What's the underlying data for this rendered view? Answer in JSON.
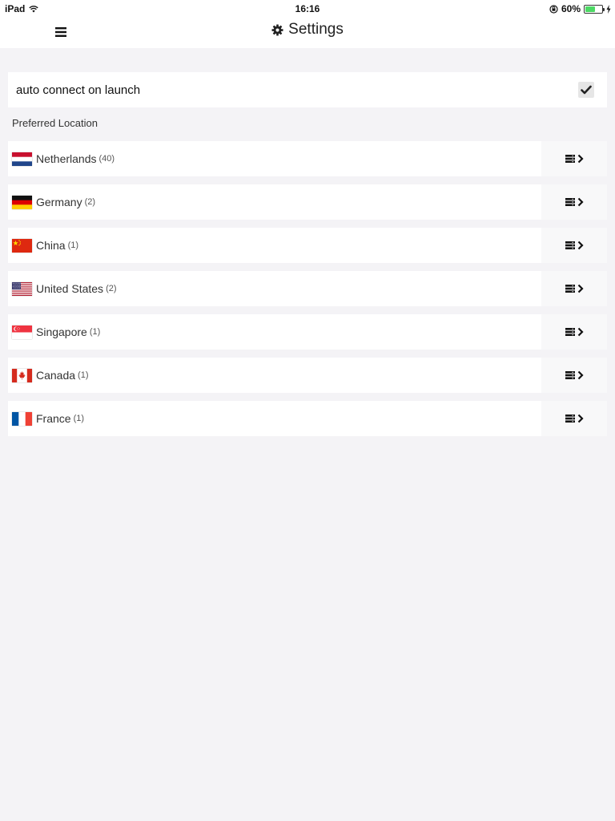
{
  "status_bar": {
    "device": "iPad",
    "time": "16:16",
    "battery": "60%",
    "battery_level": 0.6
  },
  "nav": {
    "title": "Settings"
  },
  "settings": {
    "auto_connect_label": "auto connect on launch",
    "auto_connect_checked": true,
    "preferred_location_label": "Preferred Location"
  },
  "locations": [
    {
      "name": "Netherlands",
      "count": "(40)",
      "flag": "netherlands"
    },
    {
      "name": "Germany",
      "count": "(2)",
      "flag": "germany"
    },
    {
      "name": "China",
      "count": "(1)",
      "flag": "china"
    },
    {
      "name": "United States",
      "count": "(2)",
      "flag": "usa"
    },
    {
      "name": "Singapore",
      "count": "(1)",
      "flag": "singapore"
    },
    {
      "name": "Canada",
      "count": "(1)",
      "flag": "canada"
    },
    {
      "name": "France",
      "count": "(1)",
      "flag": "france"
    }
  ],
  "icons": {
    "menu": "menu-icon",
    "gear": "gear-icon",
    "server_list": "server-list-icon",
    "chevron": "chevron-right-icon",
    "check": "check-icon"
  },
  "colors": {
    "background": "#f4f3f6",
    "battery_green": "#4cd964"
  }
}
